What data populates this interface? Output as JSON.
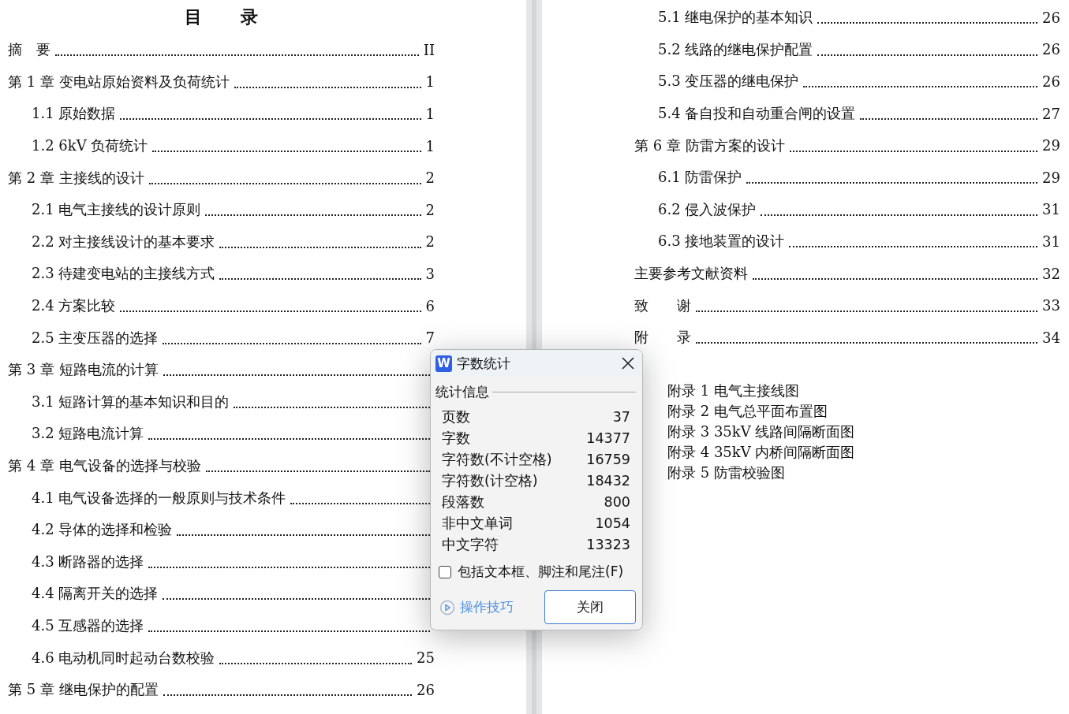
{
  "document": {
    "title": "目　录",
    "toc_left": [
      {
        "kind": "chapter",
        "label": "摘　要",
        "page": "II"
      },
      {
        "kind": "chapter",
        "label": "第 1 章  变电站原始资料及负荷统计",
        "page": "1"
      },
      {
        "kind": "section",
        "label": "1.1 原始数据",
        "page": "1"
      },
      {
        "kind": "section",
        "label": "1.2 6kV 负荷统计",
        "page": "1"
      },
      {
        "kind": "chapter",
        "label": "第 2 章  主接线的设计",
        "page": "2"
      },
      {
        "kind": "section",
        "label": "2.1 电气主接线的设计原则",
        "page": "2"
      },
      {
        "kind": "section",
        "label": "2.2 对主接线设计的基本要求",
        "page": "2"
      },
      {
        "kind": "section",
        "label": "2.3 待建变电站的主接线方式",
        "page": "3"
      },
      {
        "kind": "section",
        "label": "2.4 方案比较",
        "page": "6"
      },
      {
        "kind": "section",
        "label": "2.5 主变压器的选择",
        "page": "7"
      },
      {
        "kind": "chapter",
        "label": "第 3 章  短路电流的计算"
      },
      {
        "kind": "section",
        "label": "3.1 短路计算的基本知识和目的"
      },
      {
        "kind": "section",
        "label": "3.2 短路电流计算"
      },
      {
        "kind": "chapter",
        "label": "第 4 章  电气设备的选择与校验"
      },
      {
        "kind": "section",
        "label": "4.1 电气设备选择的一般原则与技术条件"
      },
      {
        "kind": "section",
        "label": "4.2 导体的选择和检验"
      },
      {
        "kind": "section",
        "label": "4.3 断路器的选择"
      },
      {
        "kind": "section",
        "label": "4.4 隔离开关的选择"
      },
      {
        "kind": "section",
        "label": "4.5 互感器的选择"
      },
      {
        "kind": "section",
        "label": "4.6 电动机同时起动台数校验",
        "page": "25"
      },
      {
        "kind": "chapter",
        "label": "第 5 章  继电保护的配置",
        "page": "26"
      }
    ],
    "toc_right": [
      {
        "kind": "section",
        "label": "5.1 继电保护的基本知识",
        "page": "26"
      },
      {
        "kind": "section",
        "label": "5.2 线路的继电保护配置",
        "page": "26"
      },
      {
        "kind": "section",
        "label": "5.3 变压器的继电保护",
        "page": "26"
      },
      {
        "kind": "section",
        "label": "5.4 备自投和自动重合闸的设置",
        "page": "27"
      },
      {
        "kind": "chapter",
        "label": "第 6 章  防雷方案的设计",
        "page": "29"
      },
      {
        "kind": "section",
        "label": "6.1 防雷保护",
        "page": "29"
      },
      {
        "kind": "section",
        "label": "6.2 侵入波保护",
        "page": "31"
      },
      {
        "kind": "section",
        "label": "6.3 接地装置的设计",
        "page": "31"
      },
      {
        "kind": "chapter",
        "label": "主要参考文献资料",
        "page": "32"
      },
      {
        "kind": "chapter",
        "label": "致　　谢",
        "page": "33"
      },
      {
        "kind": "chapter",
        "label": "附　　录",
        "page": "34"
      }
    ],
    "appendix_list": [
      "附录 1  电气主接线图",
      "附录 2  电气总平面布置图",
      "附录 3  35kV 线路间隔断面图",
      "附录 4  35kV 内桥间隔断面图",
      "附录 5  防雷校验图"
    ]
  },
  "dialog": {
    "logo_letter": "W",
    "title": "字数统计",
    "group_label": "统计信息",
    "stats": [
      {
        "label": "页数",
        "value": "37"
      },
      {
        "label": "字数",
        "value": "14377"
      },
      {
        "label": "字符数(不计空格)",
        "value": "16759"
      },
      {
        "label": "字符数(计空格)",
        "value": "18432"
      },
      {
        "label": "段落数",
        "value": "800"
      },
      {
        "label": "非中文单词",
        "value": "1054"
      },
      {
        "label": "中文字符",
        "value": "13323"
      }
    ],
    "checkbox": {
      "label": "包括文本框、脚注和尾注(F)",
      "checked": false
    },
    "tips_link": "操作技巧",
    "close_button": "关闭"
  }
}
